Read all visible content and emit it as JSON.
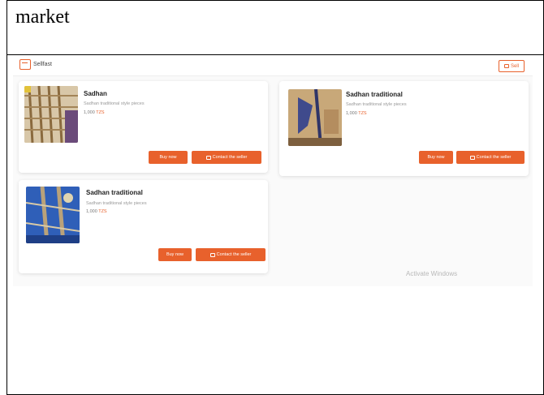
{
  "document": {
    "title": "market"
  },
  "app": {
    "brand": "Sellfast",
    "header_button": "Sell",
    "accent_color": "#e8612c"
  },
  "listings": [
    {
      "title": "Sadhan",
      "description": "Sadhan traditional style pieces",
      "price": "1,000",
      "price_suffix": "TZS",
      "buy_label": "Buy now",
      "contact_label": "Contact the seller"
    },
    {
      "title": "Sadhan traditional",
      "description": "Sadhan traditional style pieces",
      "price": "1,000",
      "price_suffix": "TZS",
      "buy_label": "Buy now",
      "contact_label": "Contact the seller"
    },
    {
      "title": "Sadhan traditional",
      "description": "Sadhan traditional style pieces",
      "price": "1,000",
      "price_suffix": "TZS",
      "buy_label": "Buy now",
      "contact_label": "Contact the seller"
    }
  ],
  "watermark": "Activate Windows"
}
